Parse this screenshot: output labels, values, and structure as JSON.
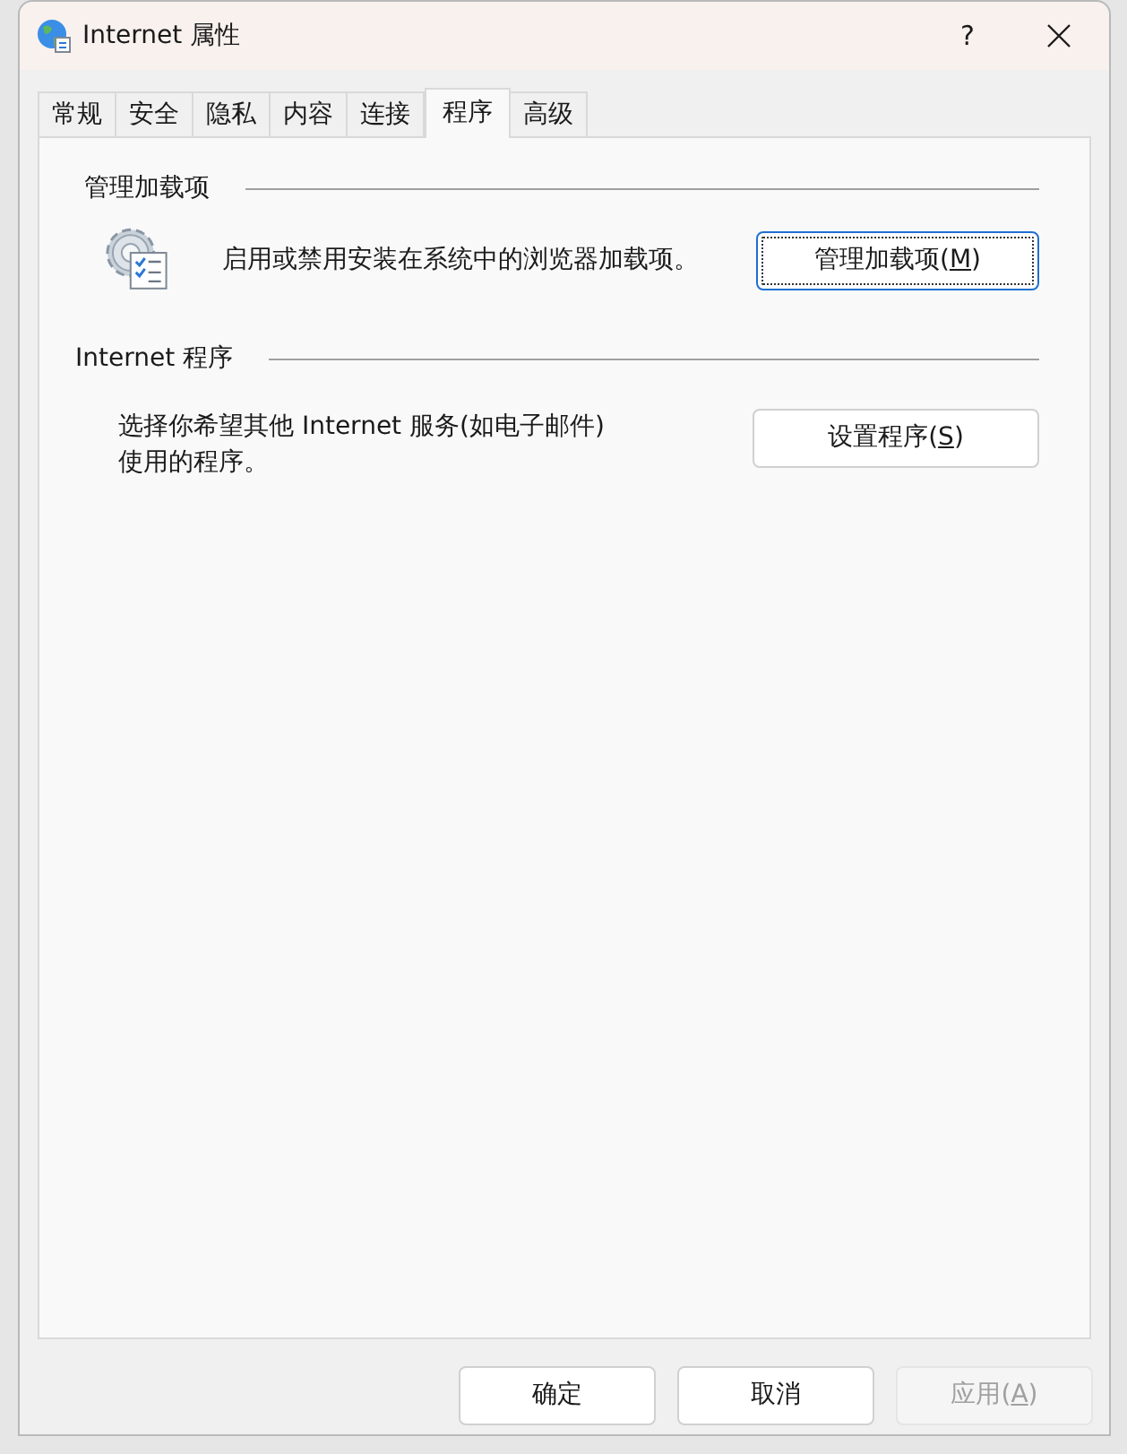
{
  "window": {
    "title": "Internet 属性",
    "help": "?"
  },
  "tabs": [
    {
      "label": "常规",
      "selected": false
    },
    {
      "label": "安全",
      "selected": false
    },
    {
      "label": "隐私",
      "selected": false
    },
    {
      "label": "内容",
      "selected": false
    },
    {
      "label": "连接",
      "selected": false
    },
    {
      "label": "程序",
      "selected": true
    },
    {
      "label": "高级",
      "selected": false
    }
  ],
  "sections": [
    {
      "title": "管理加载项",
      "description": "启用或禁用安装在系统中的浏览器加载项。",
      "kind": "with_icon",
      "button": {
        "label_before": "管理加载项(",
        "mnemonic": "M",
        "label_after": ")",
        "focused": true
      }
    },
    {
      "title": "Internet 程序",
      "description": "选择你希望其他 Internet 服务(如电子邮件)使用的程序。",
      "kind": "plain",
      "button": {
        "label_before": "设置程序(",
        "mnemonic": "S",
        "label_after": ")",
        "focused": false
      }
    }
  ],
  "buttons": [
    {
      "label_before": "确定",
      "disabled": false
    },
    {
      "label_before": "取消",
      "disabled": false
    },
    {
      "label_before": "应用(",
      "mnemonic": "A",
      "label_after": ")",
      "disabled": true
    }
  ]
}
